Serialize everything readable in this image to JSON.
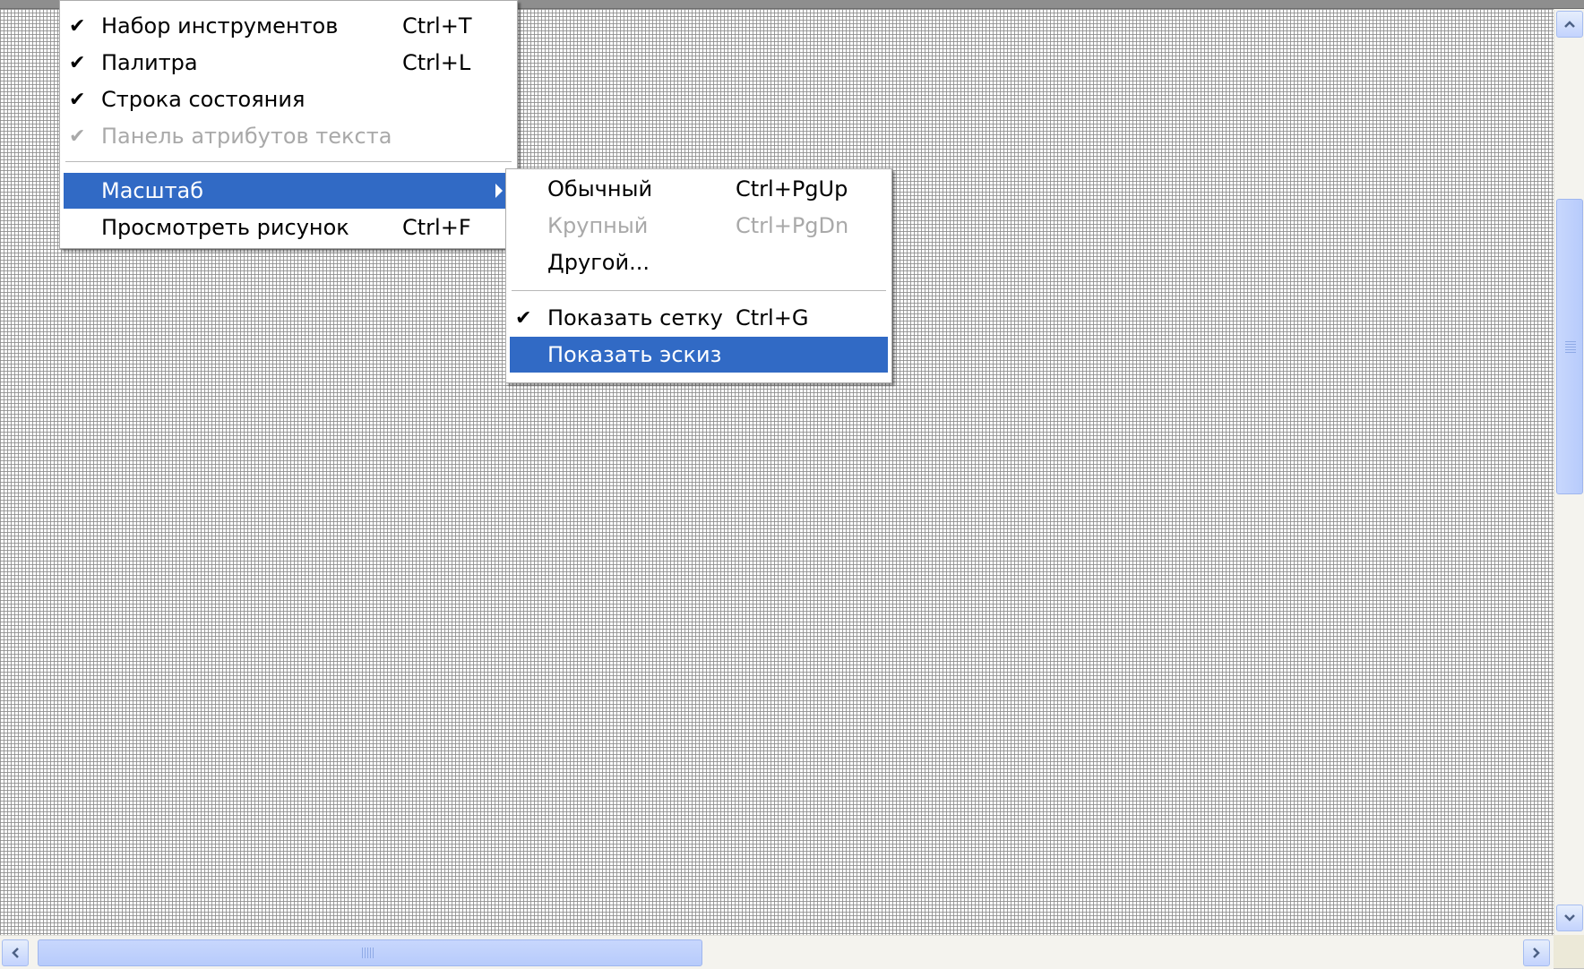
{
  "view_menu": {
    "items": [
      {
        "label": "Набор инструментов",
        "shortcut": "Ctrl+T",
        "checked": true,
        "disabled": false
      },
      {
        "label": "Палитра",
        "shortcut": "Ctrl+L",
        "checked": true,
        "disabled": false
      },
      {
        "label": "Строка состояния",
        "shortcut": "",
        "checked": true,
        "disabled": false
      },
      {
        "label": "Панель атрибутов текста",
        "shortcut": "",
        "checked": true,
        "disabled": true
      },
      {
        "label": "Масштаб",
        "shortcut": "",
        "checked": false,
        "disabled": false,
        "submenu": true,
        "highlighted": true
      },
      {
        "label": "Просмотреть рисунок",
        "shortcut": "Ctrl+F",
        "checked": false,
        "disabled": false
      }
    ]
  },
  "zoom_menu": {
    "items": [
      {
        "label": "Обычный",
        "shortcut": "Ctrl+PgUp",
        "checked": false,
        "disabled": false
      },
      {
        "label": "Крупный",
        "shortcut": "Ctrl+PgDn",
        "checked": false,
        "disabled": true
      },
      {
        "label": "Другой...",
        "shortcut": "",
        "checked": false,
        "disabled": false
      },
      {
        "label": "Показать сетку",
        "shortcut": "Ctrl+G",
        "checked": true,
        "disabled": false
      },
      {
        "label": "Показать эскиз",
        "shortcut": "",
        "checked": false,
        "disabled": false,
        "highlighted": true
      }
    ]
  },
  "glyphs": {
    "check": "✔"
  },
  "colors": {
    "highlight": "#316ac5",
    "disabled_text": "#a9a9a9",
    "scrollbar_thumb": "#c1d3fb"
  },
  "icons": [
    "checkmark-icon",
    "submenu-arrow-icon",
    "scroll-up-icon",
    "scroll-down-icon",
    "scroll-left-icon",
    "scroll-right-icon"
  ]
}
